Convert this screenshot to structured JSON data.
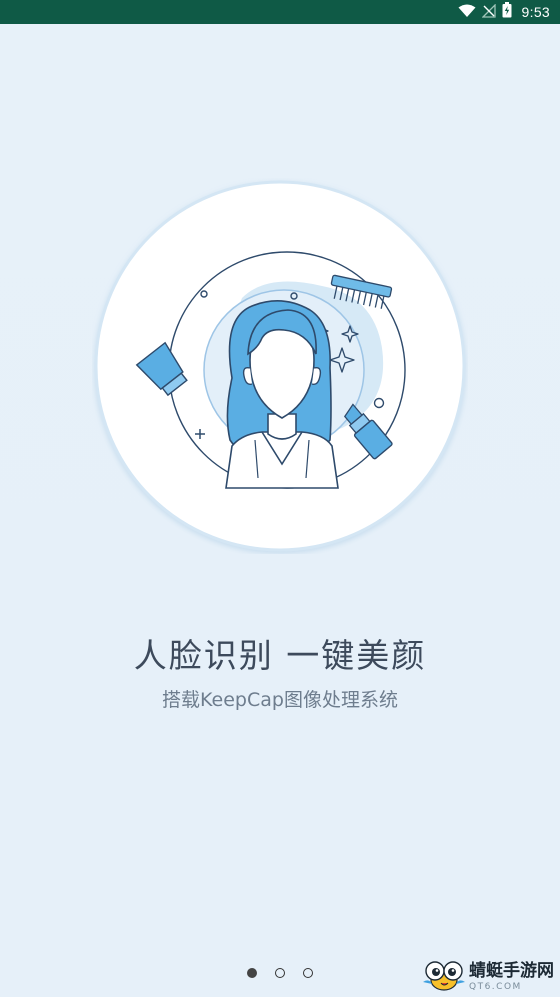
{
  "status_bar": {
    "time": "9:53",
    "icons": [
      "wifi-icon",
      "signal-icon",
      "battery-icon"
    ],
    "background": "#0f5a46"
  },
  "onboarding": {
    "headline": "人脸识别 一键美颜",
    "subline": "搭载KeepCap图像处理系统",
    "illustration_icons": [
      "woman-portrait-icon",
      "comb-icon",
      "lotion-tube-icon",
      "lipstick-icon",
      "sparkle-icon"
    ],
    "pager": {
      "total": 3,
      "current": 1
    }
  },
  "watermark": {
    "title": "蜻蜓手游网",
    "url": "QT6.COM"
  },
  "colors": {
    "background": "#e7f1f9",
    "accent_blue": "#5aaee3",
    "line_navy": "#2e4a6b"
  }
}
